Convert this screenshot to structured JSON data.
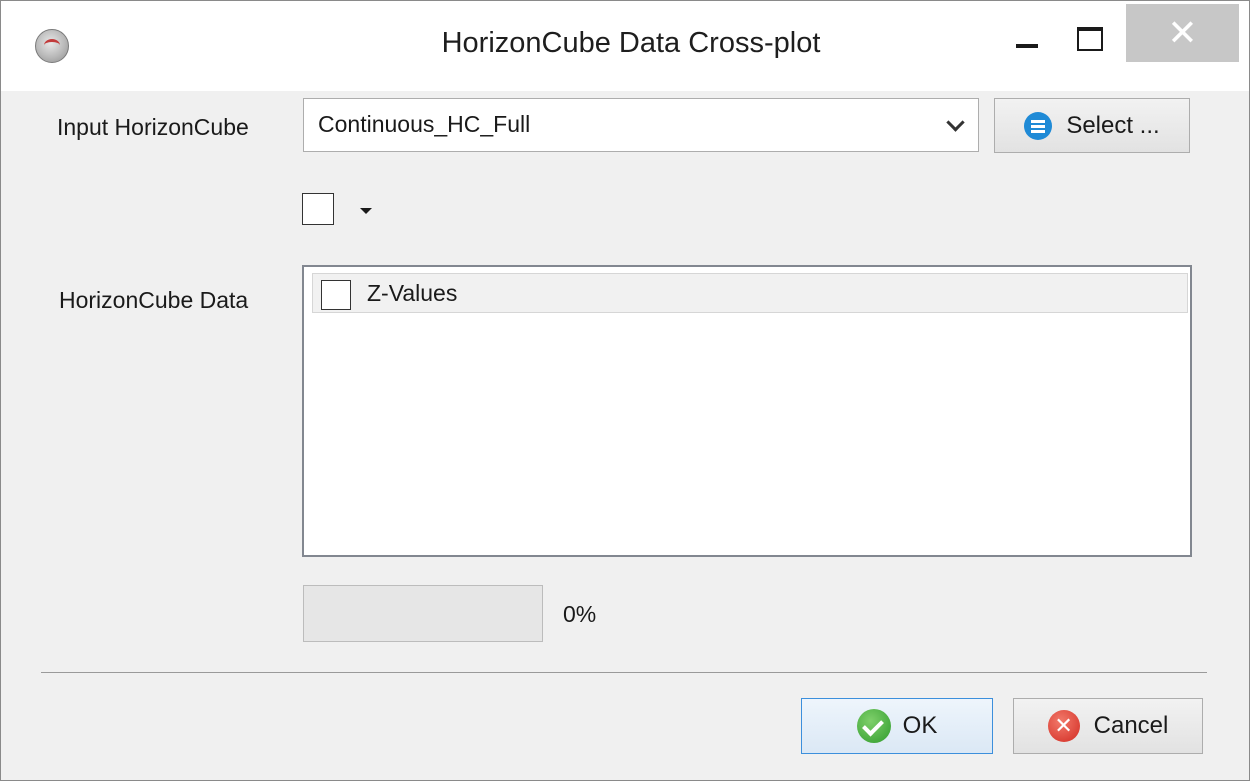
{
  "window": {
    "title": "HorizonCube Data Cross-plot",
    "close_glyph": "✕"
  },
  "input": {
    "label": "Input HorizonCube",
    "selected_value": "Continuous_HC_Full",
    "select_button_label": "Select ..."
  },
  "data_list": {
    "label": "HorizonCube Data",
    "items": [
      {
        "label": "Z-Values",
        "checked": false
      }
    ]
  },
  "progress": {
    "value": 0,
    "text": "0%"
  },
  "buttons": {
    "ok_label": "OK",
    "cancel_label": "Cancel",
    "cancel_glyph": "✕"
  },
  "icons": {
    "app": "opendtect-app-icon",
    "select": "list-icon",
    "ok": "check-circle-icon",
    "cancel": "cross-circle-icon"
  },
  "colors": {
    "close_button_bg": "#c7c7c7",
    "select_icon": "#1f8ad6",
    "ok_icon": "#3aa536",
    "cancel_icon": "#d93a2b",
    "ok_button_border": "#3c8fdc"
  }
}
